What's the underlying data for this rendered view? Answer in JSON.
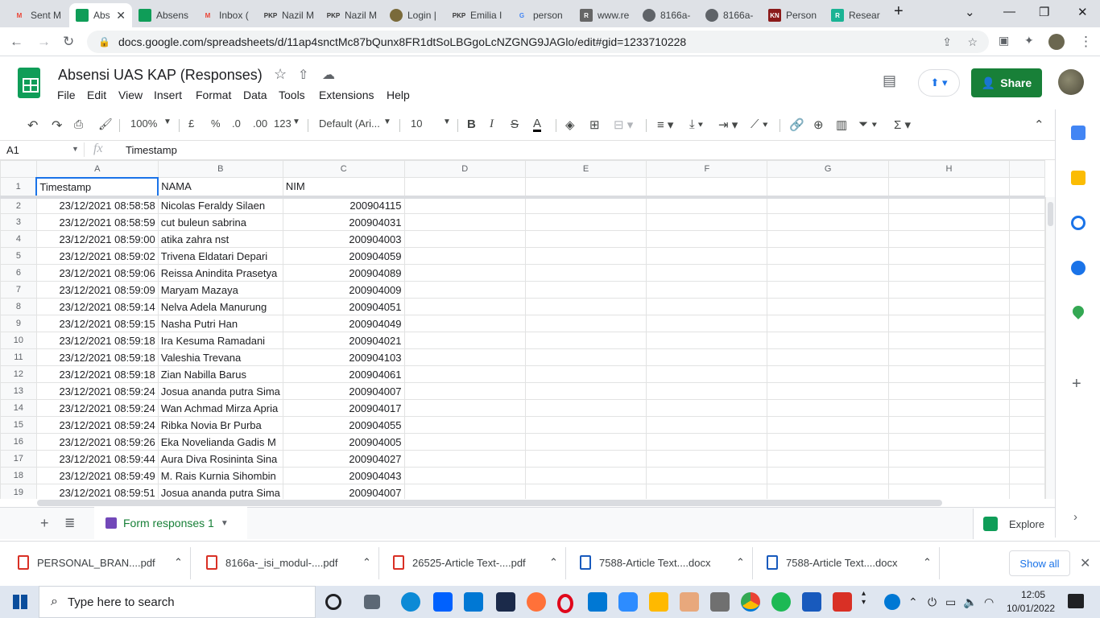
{
  "browser": {
    "tabs": [
      {
        "label": "Sent M",
        "icon": "gmail-icon",
        "fav": "M",
        "color": "#ea4335"
      },
      {
        "label": "Abs",
        "icon": "sheets-icon",
        "fav": "",
        "color": "#0f9d58",
        "active": true
      },
      {
        "label": "Absens",
        "icon": "sheets-icon",
        "fav": "",
        "color": "#0f9d58"
      },
      {
        "label": "Inbox (",
        "icon": "gmail-icon",
        "fav": "M",
        "color": "#ea4335"
      },
      {
        "label": "Nazil M",
        "icon": "pkp-icon",
        "fav": "PKP",
        "color": "#333"
      },
      {
        "label": "Nazil M",
        "icon": "pkp-icon",
        "fav": "PKP",
        "color": "#333"
      },
      {
        "label": "Login |",
        "icon": "globe-icon",
        "fav": "",
        "color": "#7a6a3a"
      },
      {
        "label": "Emilia I",
        "icon": "pkp-icon",
        "fav": "PKP",
        "color": "#333"
      },
      {
        "label": "person",
        "icon": "google-icon",
        "fav": "G",
        "color": "#4285f4"
      },
      {
        "label": "www.re",
        "icon": "r-icon",
        "fav": "R",
        "color": "#666"
      },
      {
        "label": "8166a-",
        "icon": "globe-icon",
        "fav": "",
        "color": "#5f6368"
      },
      {
        "label": "8166a-",
        "icon": "globe-icon",
        "fav": "",
        "color": "#5f6368"
      },
      {
        "label": "Person",
        "icon": "kn-icon",
        "fav": "KN",
        "color": "#8b1a1a"
      },
      {
        "label": "Resear",
        "icon": "r-icon",
        "fav": "R",
        "color": "#1ab394"
      }
    ],
    "url": "docs.google.com/spreadsheets/d/11ap4snctMc87bQunx8FR1dtSoLBGgoLcNZGNG9JAGlo/edit#gid=1233710228"
  },
  "doc": {
    "title": "Absensi UAS KAP (Responses)",
    "menus": [
      "File",
      "Edit",
      "View",
      "Insert",
      "Format",
      "Data",
      "Tools",
      "Extensions",
      "Help"
    ],
    "share_label": "Share"
  },
  "toolbar": {
    "zoom": "100%",
    "currency": "£",
    "percent": "%",
    "dec_less": ".0",
    "dec_more": ".00",
    "format_more": "123",
    "font": "Default (Ari...",
    "font_size": "10"
  },
  "formula_bar": {
    "cell_ref": "A1",
    "fx": "fx",
    "content": "Timestamp"
  },
  "sheet": {
    "columns": [
      "A",
      "B",
      "C",
      "D",
      "E",
      "F",
      "G",
      "H"
    ],
    "header_row": {
      "num": "1",
      "a": "Timestamp",
      "b": "NAMA",
      "c": "NIM"
    },
    "rows": [
      {
        "num": "2",
        "a": "23/12/2021 08:58:58",
        "b": "Nicolas Feraldy Silaen",
        "c": "200904115"
      },
      {
        "num": "3",
        "a": "23/12/2021 08:58:59",
        "b": "cut buleun sabrina",
        "c": "200904031"
      },
      {
        "num": "4",
        "a": "23/12/2021 08:59:00",
        "b": "atika zahra nst",
        "c": "200904003"
      },
      {
        "num": "5",
        "a": "23/12/2021 08:59:02",
        "b": "Trivena Eldatari Depari",
        "c": "200904059"
      },
      {
        "num": "6",
        "a": "23/12/2021 08:59:06",
        "b": "Reissa Anindita Prasetya",
        "c": "200904089"
      },
      {
        "num": "7",
        "a": "23/12/2021 08:59:09",
        "b": "Maryam Mazaya",
        "c": "200904009"
      },
      {
        "num": "8",
        "a": "23/12/2021 08:59:14",
        "b": "Nelva Adela Manurung",
        "c": "200904051"
      },
      {
        "num": "9",
        "a": "23/12/2021 08:59:15",
        "b": "Nasha Putri Han",
        "c": "200904049"
      },
      {
        "num": "10",
        "a": "23/12/2021 08:59:18",
        "b": "Ira Kesuma Ramadani",
        "c": "200904021"
      },
      {
        "num": "11",
        "a": "23/12/2021 08:59:18",
        "b": "Valeshia Trevana",
        "c": "200904103"
      },
      {
        "num": "12",
        "a": "23/12/2021 08:59:18",
        "b": "Zian Nabilla Barus",
        "c": "200904061"
      },
      {
        "num": "13",
        "a": "23/12/2021 08:59:24",
        "b": "Josua ananda putra Sima",
        "c": "200904007"
      },
      {
        "num": "14",
        "a": "23/12/2021 08:59:24",
        "b": "Wan Achmad Mirza Apria",
        "c": "200904017"
      },
      {
        "num": "15",
        "a": "23/12/2021 08:59:24",
        "b": "Ribka Novia Br Purba",
        "c": "200904055"
      },
      {
        "num": "16",
        "a": "23/12/2021 08:59:26",
        "b": "Eka Novelianda Gadis M",
        "c": "200904005"
      },
      {
        "num": "17",
        "a": "23/12/2021 08:59:44",
        "b": "Aura Diva Rosininta Sina",
        "c": "200904027"
      },
      {
        "num": "18",
        "a": "23/12/2021 08:59:49",
        "b": "M. Rais Kurnia Sihombin",
        "c": "200904043"
      },
      {
        "num": "19",
        "a": "23/12/2021 08:59:51",
        "b": "Josua ananda putra Sima",
        "c": "200904007"
      }
    ],
    "tab_label": "Form responses 1",
    "explore_label": "Explore"
  },
  "downloads": [
    {
      "name": "PERSONAL_BRAN....pdf",
      "type": "pdf"
    },
    {
      "name": "8166a-_isi_modul-....pdf",
      "type": "pdf"
    },
    {
      "name": "26525-Article Text-....pdf",
      "type": "pdf"
    },
    {
      "name": "7588-Article Text....docx",
      "type": "docx"
    },
    {
      "name": "7588-Article Text....docx",
      "type": "docx"
    }
  ],
  "downloads_show_all": "Show all",
  "taskbar": {
    "search_placeholder": "Type here to search",
    "time": "12:05",
    "date": "10/01/2022"
  },
  "colors": {
    "sheets_green": "#0f9d58",
    "share_green": "#188038",
    "selection_blue": "#1a73e8"
  }
}
